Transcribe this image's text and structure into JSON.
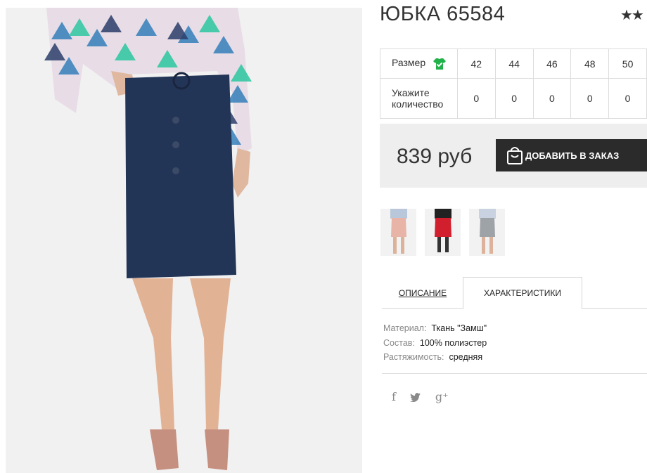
{
  "product": {
    "title": "ЮБКА 65584",
    "rating_stars": "★★"
  },
  "sizes": {
    "size_label": "Размер",
    "qty_label": "Укажите количество",
    "values": [
      "42",
      "44",
      "46",
      "48",
      "50"
    ],
    "quantities": [
      "0",
      "0",
      "0",
      "0",
      "0"
    ],
    "icon": "size-chart-icon",
    "icon_color": "#21b14a"
  },
  "order": {
    "price": "839 руб",
    "add_button": "ДОБАВИТЬ В ЗАКАЗ",
    "button_icon": "shopping-bag-icon"
  },
  "variants": [
    {
      "color": "pink",
      "skirt_color": "#e8b4a8"
    },
    {
      "color": "red",
      "skirt_color": "#d11f2e"
    },
    {
      "color": "grey",
      "skirt_color": "#9ea3a8"
    }
  ],
  "tabs": {
    "description": "ОПИСАНИЕ",
    "characteristics": "ХАРАКТЕРИСТИКИ",
    "active": "characteristics"
  },
  "specs": [
    {
      "key": "Материал:",
      "value": "Ткань \"Замш\""
    },
    {
      "key": "Состав:",
      "value": "100% полиэстер"
    },
    {
      "key": "Растяжимость:",
      "value": "средняя"
    }
  ],
  "social": {
    "facebook": "f",
    "twitter": "🐦",
    "googleplus": "g⁺"
  }
}
